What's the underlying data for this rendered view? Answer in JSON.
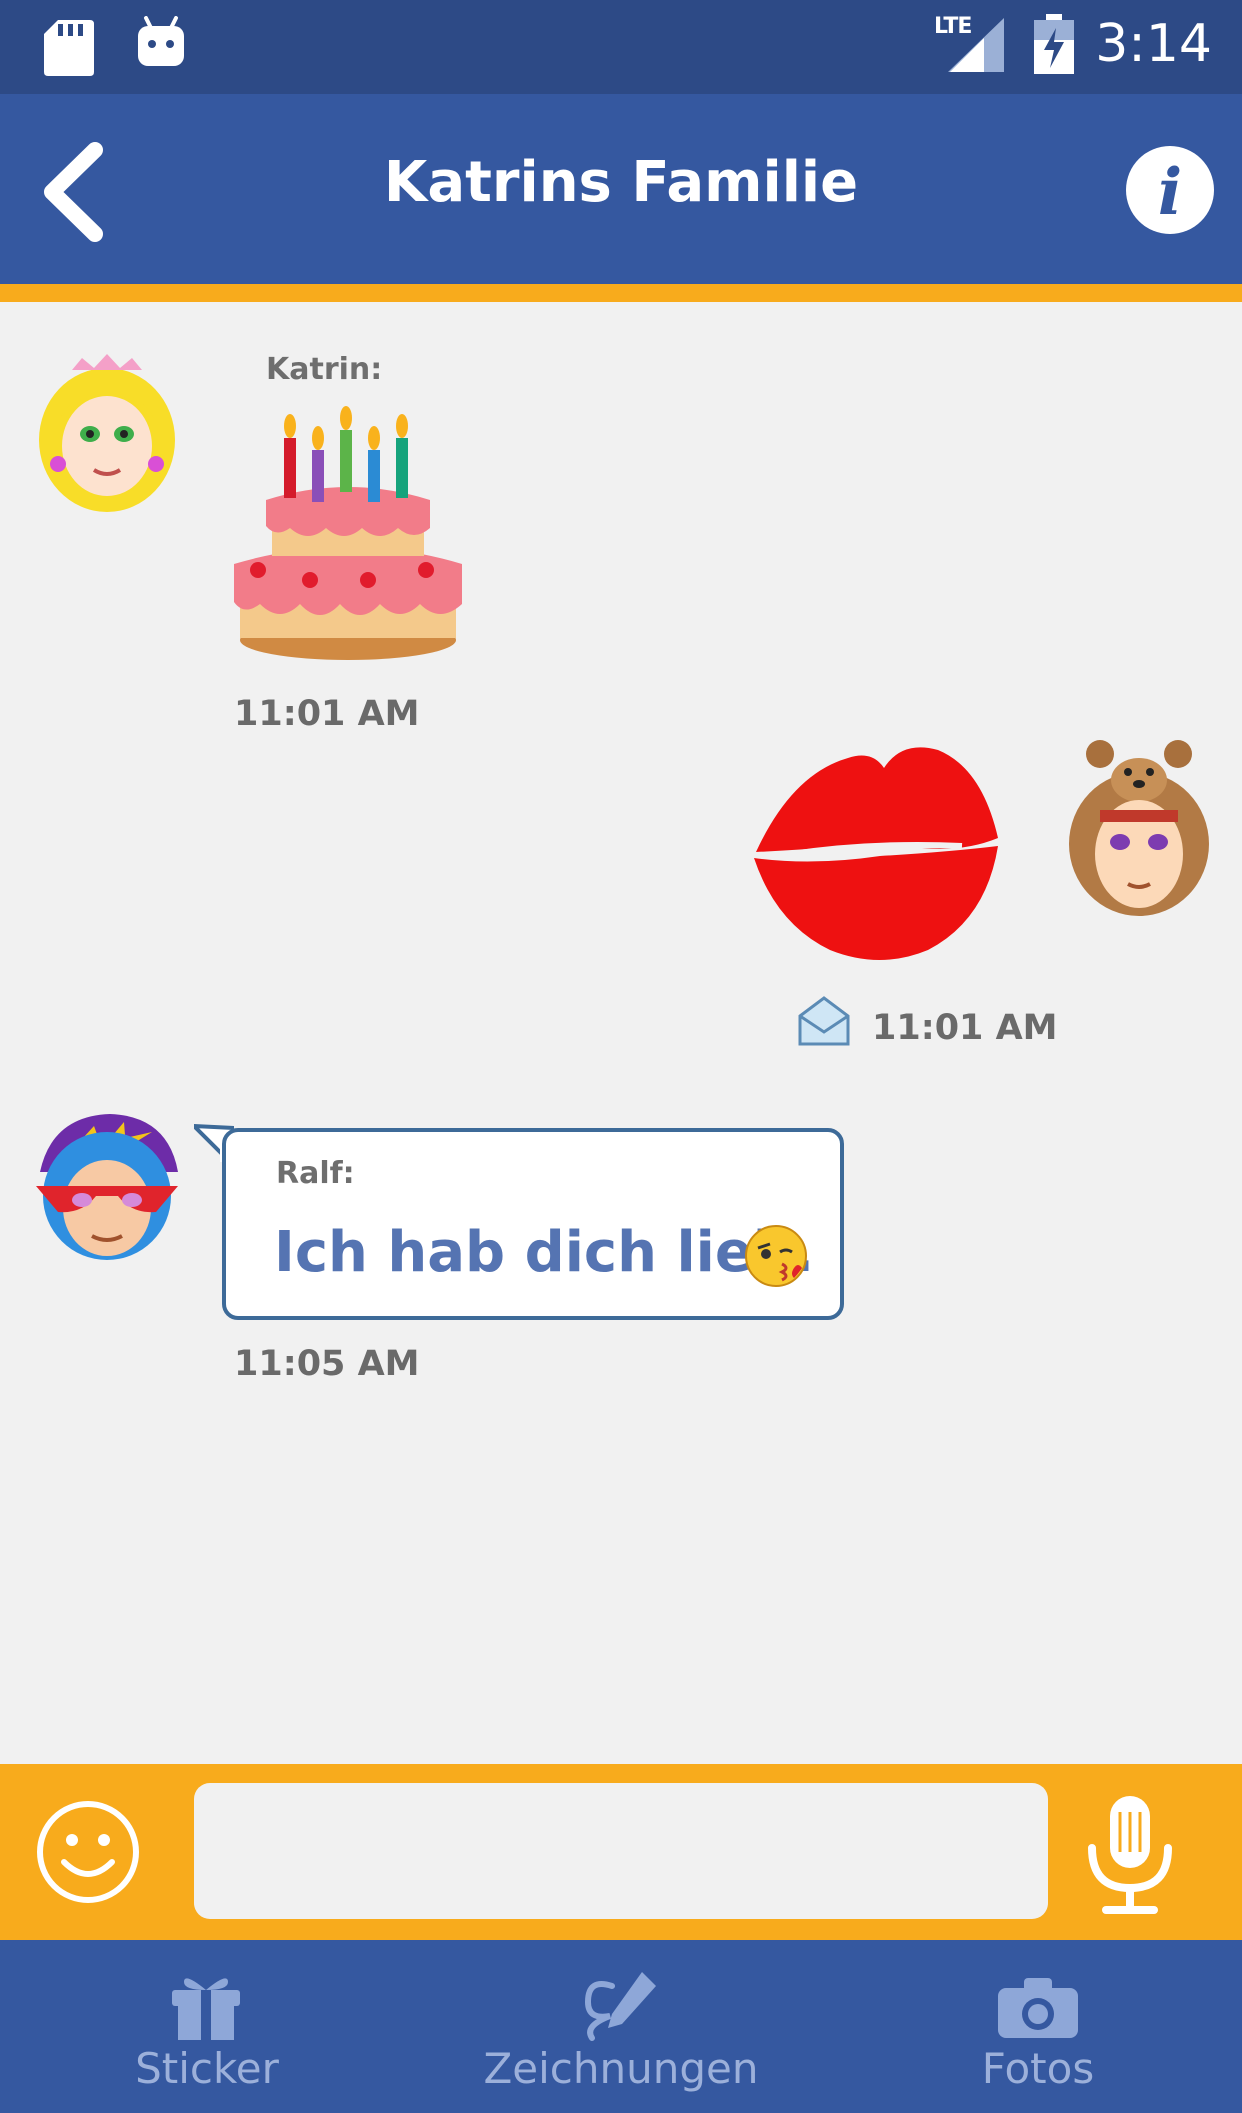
{
  "status_bar": {
    "time": "3:14",
    "network": "LTE"
  },
  "header": {
    "title": "Katrins Familie"
  },
  "messages": [
    {
      "sender": "Katrin:",
      "time": "11:01 AM",
      "sticker": "birthday-cake"
    },
    {
      "time": "11:01 AM",
      "sticker": "kiss-lips",
      "status": "envelope"
    },
    {
      "sender": "Ralf:",
      "text": "Ich hab dich lieb.",
      "time": "11:05 AM",
      "emoji": "kiss-face"
    }
  ],
  "input": {
    "placeholder": ""
  },
  "bottom_nav": [
    {
      "label": "Sticker",
      "icon": "gift-icon"
    },
    {
      "label": "Zeichnungen",
      "icon": "pen-icon"
    },
    {
      "label": "Fotos",
      "icon": "camera-icon"
    }
  ],
  "colors": {
    "header_blue": "#3558a0",
    "status_blue": "#2d4a86",
    "accent_orange": "#f8ab1c",
    "message_text": "#5574b2"
  }
}
